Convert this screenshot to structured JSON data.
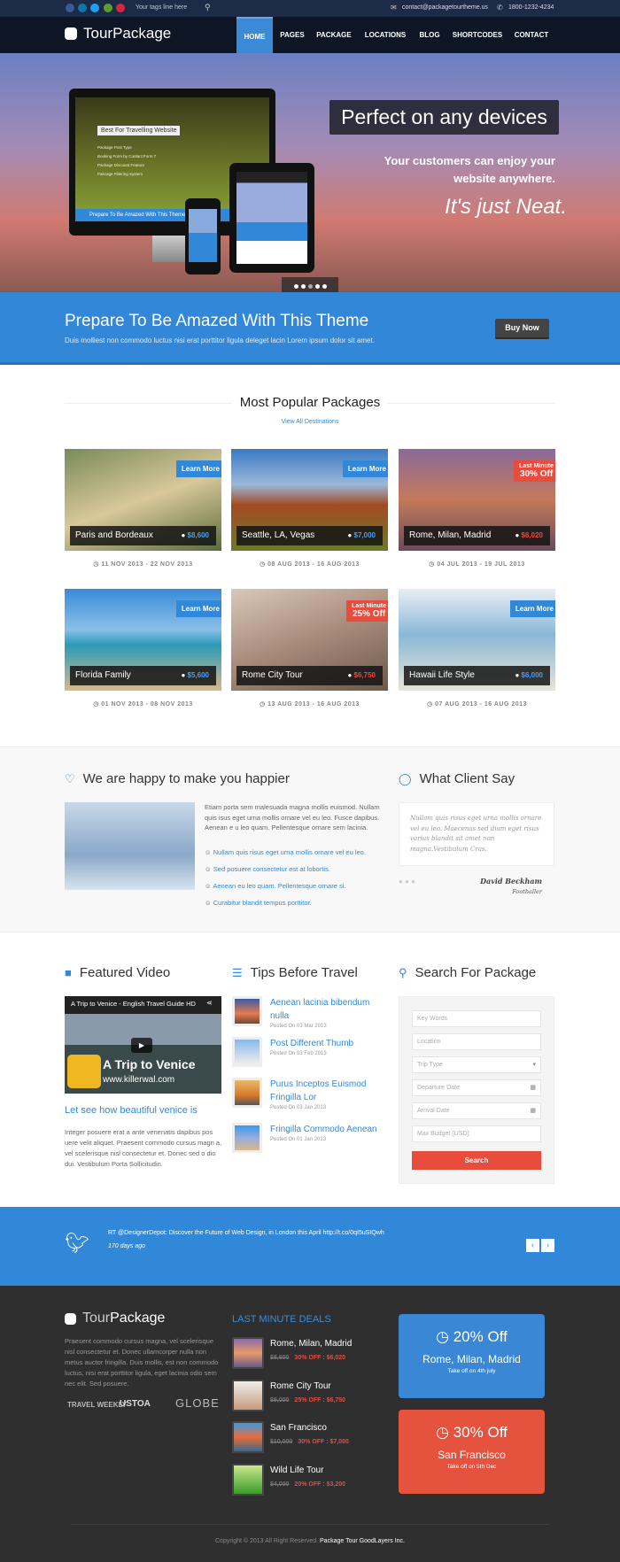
{
  "topbar": {
    "tagline": "Your tags line here",
    "email": "contact@packagetourtheme.us",
    "phone": "1800-1232-4234",
    "social": [
      "facebook-icon",
      "linkedin-icon",
      "twitter-icon",
      "email-icon",
      "pinterest-icon"
    ]
  },
  "brand": {
    "logo_light": "Tour",
    "logo_bold": "Package"
  },
  "nav": [
    "HOME",
    "PAGES",
    "PACKAGE",
    "LOCATIONS",
    "BLOG",
    "SHORTCODES",
    "CONTACT"
  ],
  "hero": {
    "headline": "Perfect on any devices",
    "sub1": "Your customers can enjoy your",
    "sub2": "website anywhere.",
    "tagline": "It's just Neat.",
    "mock_banner": "Best For Travelling Website",
    "mock_list": [
      "Package Post Type",
      "Booking Form by Contact Form 7",
      "Package Discount Feature",
      "Pakcage Filtering System"
    ],
    "mock_cta": "Prepare To Be Amazed With This Theme",
    "slides": 5
  },
  "banner": {
    "title": "Prepare To Be Amazed With This Theme",
    "text": "Duis molliest non commodo luctus nisi erat porttitor ligula deleget lacin Lorem ipsum dolor sit amet.",
    "button": "Buy Now"
  },
  "popular": {
    "title": "Most Popular Packages",
    "view_all": "View All Destinations",
    "items": [
      {
        "name": "Paris and Bordeaux",
        "price": "$8,600",
        "tag": "Learn More",
        "date": "11 NOV 2013 - 22 NOV 2013"
      },
      {
        "name": "Seattle, LA, Vegas",
        "price": "$7,000",
        "tag": "Learn More",
        "date": "08 AUG 2013 - 16 AUG 2013"
      },
      {
        "name": "Rome, Milan, Madrid",
        "price": "$6,020",
        "tag_small": "Last Minute",
        "tag": "30% Off",
        "date": "04 JUL 2013 - 19 JUL 2013"
      },
      {
        "name": "Florida Family",
        "price": "$5,600",
        "tag": "Learn More",
        "date": "01 NOV 2013 - 08 NOV 2013"
      },
      {
        "name": "Rome City Tour",
        "price": "$6,750",
        "tag_small": "Last Minute",
        "tag": "25% Off",
        "date": "13 AUG 2013 - 16 AUG 2013"
      },
      {
        "name": "Hawaii Life Style",
        "price": "$6,000",
        "tag": "Learn More",
        "date": "07 AUG 2013 - 16 AUG 2013"
      }
    ]
  },
  "happy": {
    "title": "We are happy to make you happier",
    "text": "Etiam porta sem malesuada magna mollis euismod. Nullam quis isus eget urna mollis ornare vel eu leo. Fusce dapibus. Aenean e u leo quam. Pellentesque ornare sem lacinia.",
    "list": [
      "Nullam quis risus eget urna mollis ornare vel eu leo.",
      "Sed posuere consectetur est at lobortis.",
      "Aenean eu leo quam. Pellentesque ornare si.",
      "Curabitur blandit tempus porttitor."
    ]
  },
  "client": {
    "title": "What Client Say",
    "quote": "Nullam quis risus eget urna mollis ornare vel eu leo. Maecenas sed diam eget risus varius blandit sit amet non magna.Vestibulum Cras.",
    "name": "David Beckham",
    "role": "Footballer"
  },
  "video": {
    "title": "Featured Video",
    "video_title": "A Trip to Venice - English Travel Guide HD",
    "overlay1": "A Trip to Venice",
    "overlay2": "www.killerwal.com",
    "post_title": "Let see how beautiful venice is",
    "text": "Integer posuere erat a ante venenatis dapibus pos uere velit aliquet. Praesent commodo cursus magn a, vel scelerisque nisl consectetur et. Donec sed o dio dui. Vestibulum Porta Sollicitudin."
  },
  "tips": {
    "title": "Tips Before Travel",
    "items": [
      {
        "title": "Aenean lacinia bibendum nulla",
        "date": "Posted On 03 Mar 2013"
      },
      {
        "title": "Post Different Thumb",
        "date": "Posted On 03 Feb 2013"
      },
      {
        "title": "Purus Inceptos Euismod Fringilla Lor",
        "date": "Posted On 03 Jan 2013"
      },
      {
        "title": "Fringilla Commodo Aenean",
        "date": "Posted On 01 Jan 2013"
      }
    ]
  },
  "search": {
    "title": "Search For Package",
    "fields": [
      "Key Words",
      "Location",
      "Trip Type",
      "Departure Date",
      "Arrival Date",
      "Max Budget (USD)"
    ],
    "button": "Search"
  },
  "twitter": {
    "tweet": "RT @DesignerDepot: Discover the Future of Web Design, in London this April http://t.co/0qI5uSIQwh",
    "time": "170 days ago"
  },
  "footer": {
    "about": "Praesent commodo cursus magna, vel scelerisque nisl consectetur et. Donec ullamcorper nulla non metus auctor fringilla. Duis mollis, est non commodo luctus, nisi erat porttitor ligula, eget lacinia odio sem nec elit. Sed posuere.",
    "partners": [
      "TRAVEL WEEKLY",
      "USTOA",
      "GLOBE"
    ],
    "deals_title": "LAST MINUTE DEALS",
    "deals": [
      {
        "name": "Rome, Milan, Madrid",
        "old": "$8,600",
        "new": "30% OFF : $6,020"
      },
      {
        "name": "Rome City Tour",
        "old": "$9,000",
        "new": "25% OFF : $6,750"
      },
      {
        "name": "San Francisco",
        "old": "$10,000",
        "new": "30% OFF : $7,000"
      },
      {
        "name": "Wild Life Tour",
        "old": "$4,000",
        "new": "20% OFF : $3,200"
      }
    ],
    "promos": [
      {
        "off": "20% Off",
        "place": "Rome, Milan, Madrid",
        "note": "Take off on 4th july",
        "color": "#3a87d6"
      },
      {
        "off": "30% Off",
        "place": "San Francisco",
        "note": "Take off on 5th Dec",
        "color": "#e5533f"
      }
    ],
    "copyright": "Copyright © 2013 All Right Reserved.",
    "company": "Package Tour GoodLayers Inc."
  },
  "colors": {
    "accent": "#3288d8",
    "red": "#e84c3d",
    "nav": "#0e1626",
    "footer": "#2f2f2f"
  }
}
